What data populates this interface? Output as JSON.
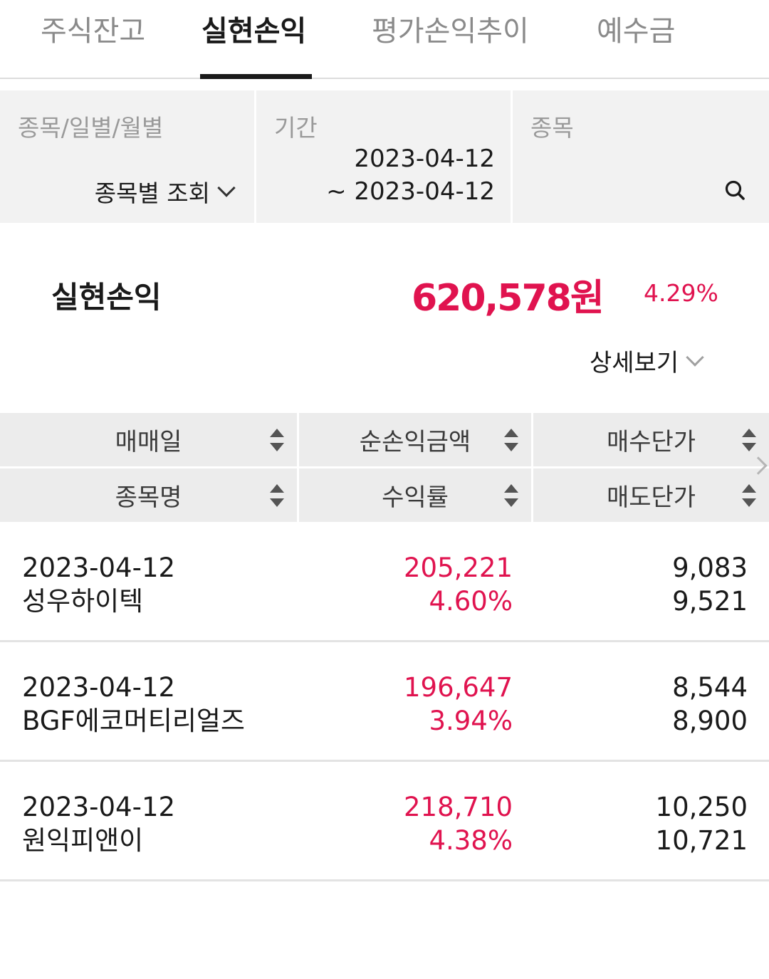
{
  "tabs": [
    {
      "label": "주식잔고",
      "active": false
    },
    {
      "label": "실현손익",
      "active": true
    },
    {
      "label": "평가손익추이",
      "active": false
    },
    {
      "label": "예수금",
      "active": false
    }
  ],
  "filter": {
    "mode_label": "종목/일별/월별",
    "mode_value": "종목별 조회",
    "period_label": "기간",
    "period_from": "2023-04-12",
    "period_to": "~ 2023-04-12",
    "stock_label": "종목"
  },
  "summary": {
    "label": "실현손익",
    "amount": "620,578원",
    "rate": "4.29%",
    "detail_label": "상세보기"
  },
  "table": {
    "headers_row1": [
      "매매일",
      "순손익금액",
      "매수단가"
    ],
    "headers_row2": [
      "종목명",
      "수익률",
      "매도단가"
    ],
    "rows": [
      {
        "date": "2023-04-12",
        "name": "성우하이텍",
        "profit": "205,221",
        "rate": "4.60%",
        "buy_price": "9,083",
        "sell_price": "9,521"
      },
      {
        "date": "2023-04-12",
        "name": "BGF에코머티리얼즈",
        "profit": "196,647",
        "rate": "3.94%",
        "buy_price": "8,544",
        "sell_price": "8,900"
      },
      {
        "date": "2023-04-12",
        "name": "원익피앤이",
        "profit": "218,710",
        "rate": "4.38%",
        "buy_price": "10,250",
        "sell_price": "10,721"
      }
    ]
  },
  "colors": {
    "accent_red": "#e0134f",
    "header_bg": "#ececec",
    "filter_bg": "#f2f2f2"
  }
}
